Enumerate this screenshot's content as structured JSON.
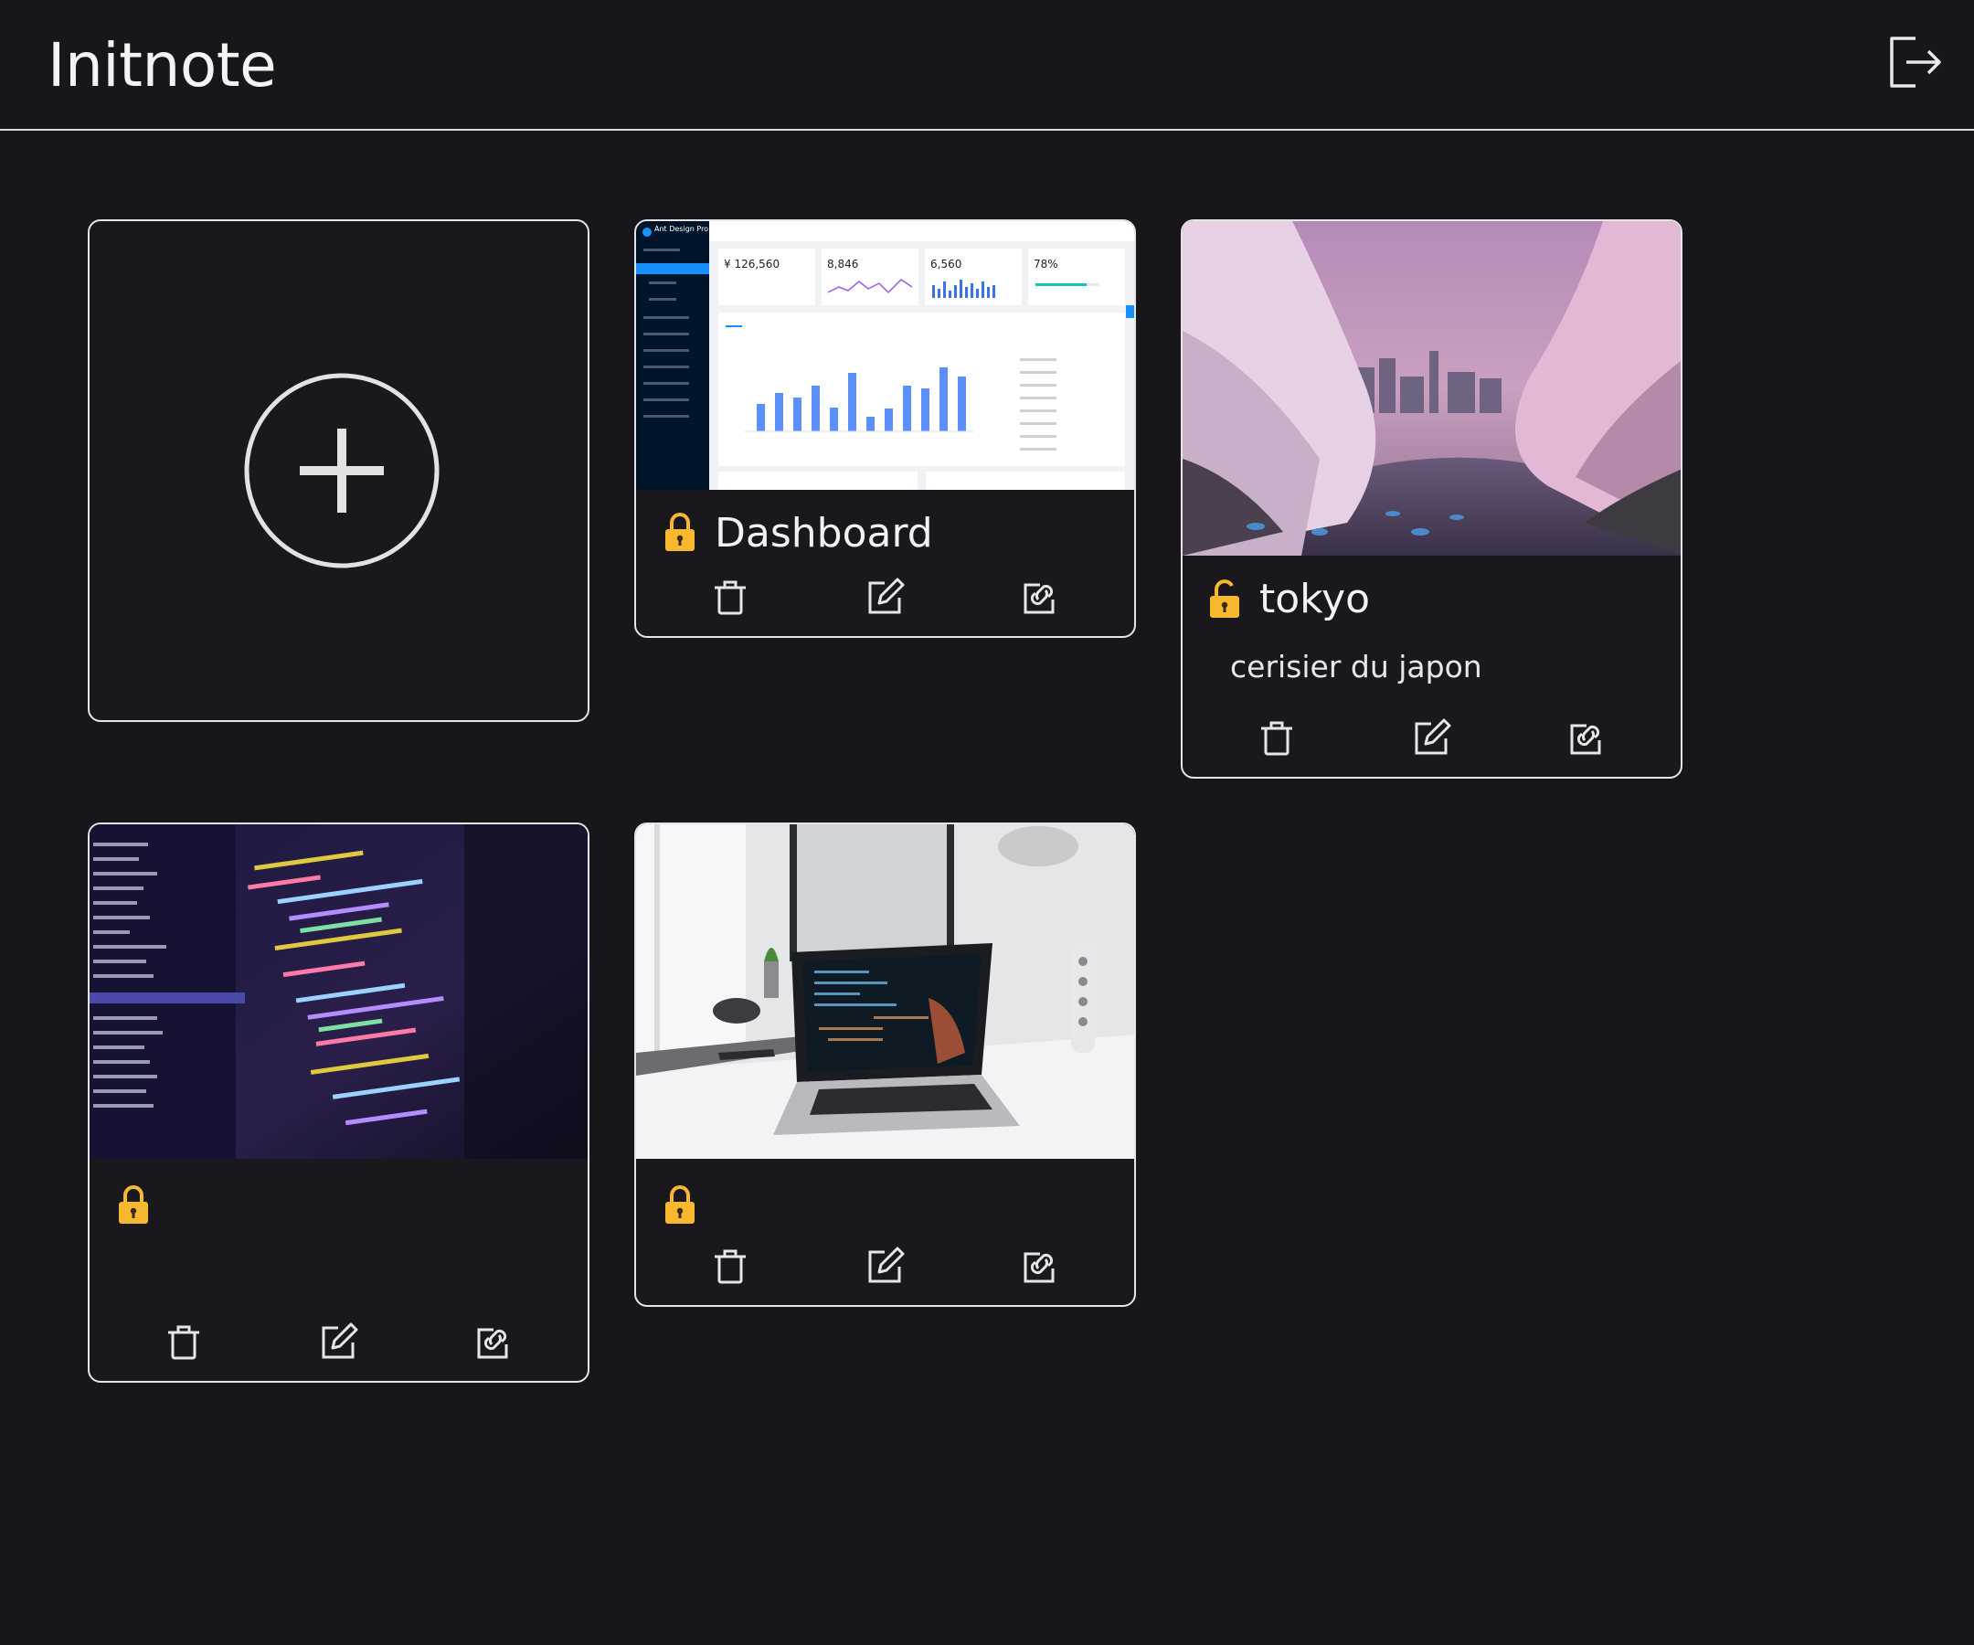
{
  "app": {
    "title": "Initnote"
  },
  "header": {
    "logout_icon": "logout-icon"
  },
  "add_card": {
    "icon": "plus-circle-icon"
  },
  "dashboard_preview": {
    "app_name": "Ant Design Pro",
    "stats": [
      "¥ 126,560",
      "8,846",
      "6,560",
      "78%"
    ]
  },
  "notes": [
    {
      "title": "Dashboard",
      "description": "",
      "lock_state": "locked",
      "thumbnail": "dashboard-screenshot"
    },
    {
      "title": "tokyo",
      "description": "cerisier du japon",
      "lock_state": "unlocked",
      "thumbnail": "cherry-blossom-photo"
    },
    {
      "title": "",
      "description": "",
      "lock_state": "locked",
      "thumbnail": "code-editor-photo"
    },
    {
      "title": "",
      "description": "",
      "lock_state": "locked",
      "thumbnail": "laptop-desk-photo"
    }
  ],
  "colors": {
    "background": "#18161a",
    "card_border": "#e5e5e5",
    "lock": "#f5b82e",
    "text": "#f2f2f2"
  }
}
